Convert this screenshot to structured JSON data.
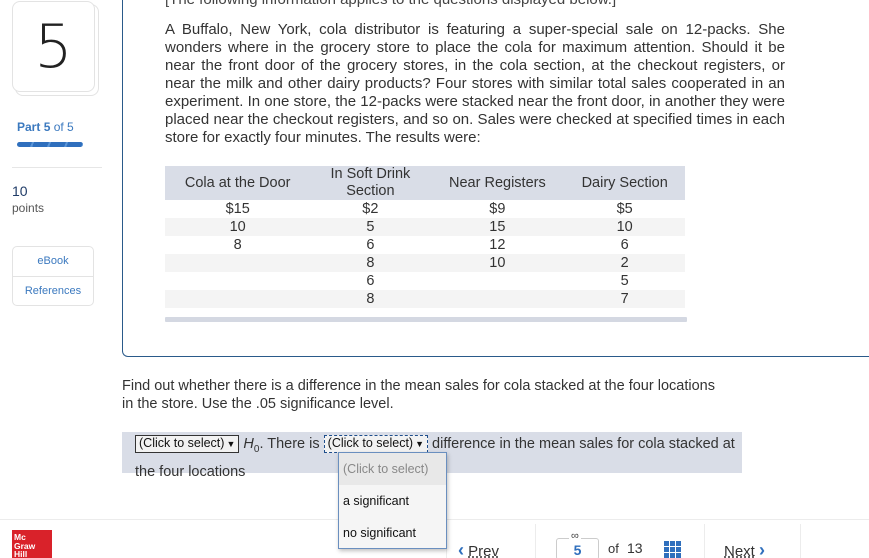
{
  "sidebar": {
    "question_number": "5",
    "part_prefix": "Part",
    "part_current": "5",
    "part_of": "of 5",
    "part_progress": 1.0,
    "points_value": "10",
    "points_label": "points",
    "resources": [
      "eBook",
      "References"
    ]
  },
  "question": {
    "clipped_top_line": "[The following information applies to the questions displayed below.]",
    "intro": "A Buffalo, New York, cola distributor is featuring a super-special sale on 12-packs. She wonders where in the grocery store to place the cola for maximum attention. Should it be near the front door of the grocery stores, in the cola section, at the checkout registers, or near the milk and other dairy products? Four stores with similar total sales cooperated in an experiment. In one store, the 12-packs were stacked near the front door, in another they were placed near the checkout registers, and so on. Sales were checked at specified times in each store for exactly four minutes. The results were:",
    "table": {
      "headers": [
        "Cola at the Door",
        "In Soft Drink Section",
        "Near Registers",
        "Dairy Section"
      ],
      "rows": [
        [
          "$15",
          "$2",
          "$9",
          "$5"
        ],
        [
          "10",
          "5",
          "15",
          "10"
        ],
        [
          "8",
          "6",
          "12",
          "6"
        ],
        [
          "",
          "8",
          "10",
          "2"
        ],
        [
          "",
          "6",
          "",
          "5"
        ],
        [
          "",
          "8",
          "",
          "7"
        ]
      ]
    },
    "instruction": "Find out whether there is a difference in the mean sales for cola stacked at the four locations in the store. Use the .05 significance level."
  },
  "answer": {
    "select1_value": "(Click to select)",
    "h0_label": "H",
    "h0_sub": "0",
    "text_after_h0": ". There is",
    "select2_value": "(Click to select)",
    "text_after_select2": "difference in the mean sales for cola stacked at the four locations",
    "dropdown_options": [
      "(Click to select)",
      "a significant",
      "no significant"
    ]
  },
  "footer": {
    "logo_lines": [
      "Mc",
      "Graw",
      "Hill"
    ],
    "prev_label": "Prev",
    "current_page": "5",
    "of_label": "of",
    "total_pages": "13",
    "next_label": "Next"
  },
  "colors": {
    "accent": "#2f6fbd",
    "panel_border": "#2a5a8a",
    "table_header_bg": "#d9dde7",
    "logo_red": "#d9222a"
  }
}
